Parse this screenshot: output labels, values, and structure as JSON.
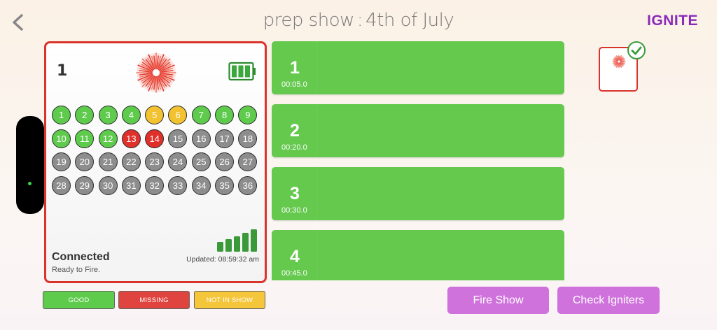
{
  "header": {
    "title_left": "prep show",
    "separator": ":",
    "title_right": "4th of July",
    "logo": "IGNITE",
    "back_icon": "chevron-left-icon"
  },
  "module": {
    "number": "1",
    "status": "Connected",
    "sub_status": "Ready to Fire.",
    "updated": "Updated: 08:59:32 am",
    "battery_level": 1.0,
    "signal_bars": 5,
    "cues": [
      {
        "n": "1",
        "state": "good"
      },
      {
        "n": "2",
        "state": "good"
      },
      {
        "n": "3",
        "state": "good"
      },
      {
        "n": "4",
        "state": "good"
      },
      {
        "n": "5",
        "state": "notinshow"
      },
      {
        "n": "6",
        "state": "notinshow"
      },
      {
        "n": "7",
        "state": "good"
      },
      {
        "n": "8",
        "state": "good"
      },
      {
        "n": "9",
        "state": "good"
      },
      {
        "n": "10",
        "state": "good"
      },
      {
        "n": "11",
        "state": "good"
      },
      {
        "n": "12",
        "state": "good"
      },
      {
        "n": "13",
        "state": "missing"
      },
      {
        "n": "14",
        "state": "missing"
      },
      {
        "n": "15",
        "state": "off"
      },
      {
        "n": "16",
        "state": "off"
      },
      {
        "n": "17",
        "state": "off"
      },
      {
        "n": "18",
        "state": "off"
      },
      {
        "n": "19",
        "state": "off"
      },
      {
        "n": "20",
        "state": "off"
      },
      {
        "n": "21",
        "state": "off"
      },
      {
        "n": "22",
        "state": "off"
      },
      {
        "n": "23",
        "state": "off"
      },
      {
        "n": "24",
        "state": "off"
      },
      {
        "n": "25",
        "state": "off"
      },
      {
        "n": "26",
        "state": "off"
      },
      {
        "n": "27",
        "state": "off"
      },
      {
        "n": "28",
        "state": "off"
      },
      {
        "n": "29",
        "state": "off"
      },
      {
        "n": "30",
        "state": "off"
      },
      {
        "n": "31",
        "state": "off"
      },
      {
        "n": "32",
        "state": "off"
      },
      {
        "n": "33",
        "state": "off"
      },
      {
        "n": "34",
        "state": "off"
      },
      {
        "n": "35",
        "state": "off"
      },
      {
        "n": "36",
        "state": "off"
      }
    ]
  },
  "legend": {
    "good": "GOOD",
    "missing": "MISSING",
    "not_in_show": "NOT IN SHOW"
  },
  "cue_list": [
    {
      "number": "1",
      "time": "00:05.0"
    },
    {
      "number": "2",
      "time": "00:20.0"
    },
    {
      "number": "3",
      "time": "00:30.0"
    },
    {
      "number": "4",
      "time": "00:45.0"
    }
  ],
  "buttons": {
    "fire_show": "Fire Show",
    "check_igniters": "Check Igniters"
  },
  "colors": {
    "good": "#5ecb4d",
    "missing": "#e0302a",
    "not_in_show": "#f3c230",
    "off": "#8d8d8d",
    "accent": "#cf72dc",
    "module_border": "#d9342b"
  }
}
